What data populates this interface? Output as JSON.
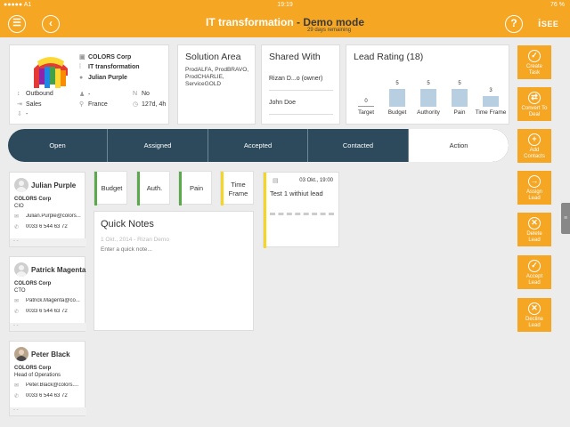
{
  "status_bar": {
    "carrier": "●●●●● A1",
    "time": "19:19",
    "battery": "76 %"
  },
  "header": {
    "title_main": "IT transformation",
    "title_sep": " - ",
    "title_mode": "Demo mode",
    "subtitle": "29 days remaining",
    "logo": "SEE",
    "menu_glyph": "☰",
    "back_glyph": "‹",
    "help_glyph": "?"
  },
  "contact_card": {
    "company": "COLORS Corp",
    "project": "IT transformation",
    "person": "Julian Purple",
    "direction": "Outbound",
    "department": "Sales",
    "extra": "-",
    "field_a": "-",
    "country": "France",
    "flag_n": "No",
    "duration": "127d, 4h"
  },
  "solution_area": {
    "title": "Solution Area",
    "items": [
      "ProdALFA, ProdBRAVO,",
      "ProdCHARLIE,",
      "ServiceGOLD"
    ]
  },
  "shared_with": {
    "title": "Shared With",
    "users": [
      "Rizan D...o (owner)",
      "John Doe"
    ]
  },
  "lead_rating": {
    "title": "Lead Rating (18)",
    "chart_data": {
      "type": "bar",
      "categories": [
        "Target",
        "Budget",
        "Authority",
        "Pain",
        "Time Frame"
      ],
      "values": [
        0,
        5,
        5,
        5,
        3
      ],
      "ylim": [
        0,
        5
      ]
    }
  },
  "pipeline": {
    "stages": [
      "Open",
      "Assigned",
      "Accepted",
      "Contacted",
      "Action"
    ],
    "active": "Action"
  },
  "sidebar": {
    "buttons": [
      {
        "label1": "Create",
        "label2": "Task",
        "glyph": "✓"
      },
      {
        "label1": "Convert To",
        "label2": "Deal",
        "glyph": "⇄"
      },
      {
        "label1": "Add",
        "label2": "Contacts",
        "glyph": "+"
      },
      {
        "label1": "Assign",
        "label2": "Lead",
        "glyph": "→"
      },
      {
        "label1": "Delete",
        "label2": "Lead",
        "glyph": "✕"
      },
      {
        "label1": "Accept",
        "label2": "Lead",
        "glyph": "✓"
      },
      {
        "label1": "Decline",
        "label2": "Lead",
        "glyph": "✕"
      }
    ]
  },
  "contacts": [
    {
      "name": "Julian Purple",
      "company": "COLORS Corp",
      "role": "CIO",
      "email": "Julian.Purple@colors...",
      "phone": "0033 6 544 63 72",
      "footer": "- -"
    },
    {
      "name": "Patrick Magenta",
      "company": "COLORS Corp",
      "role": "CTO",
      "email": "Patrick.Magenta@co...",
      "phone": "0033 6 544 63 72",
      "footer": "- -"
    },
    {
      "name": "Peter Black",
      "company": "COLORS Corp",
      "role": "Head of Operations",
      "email": "Peter.Black@colors....",
      "phone": "0033 6 544 63 72",
      "footer": "- -"
    }
  ],
  "bant": [
    {
      "label": "Budget",
      "color": "#5aa94a"
    },
    {
      "label": "Auth.",
      "color": "#5aa94a"
    },
    {
      "label": "Pain",
      "color": "#5aa94a"
    },
    {
      "label1": "Time",
      "label2": "Frame",
      "color": "#f5d623"
    }
  ],
  "quick_notes": {
    "title": "Quick Notes",
    "meta": "1 Okt., 2014 - Rizan Demo",
    "placeholder": "Enter a quick note..."
  },
  "task": {
    "date": "03 Okt., 19:00",
    "title": "Test 1 withiut lead"
  },
  "colors": {
    "accent": "#f5a623",
    "pipeline": "#2c4a5c",
    "bar": "#b8cfe2",
    "green": "#5aa94a",
    "yellow": "#f5d623"
  }
}
